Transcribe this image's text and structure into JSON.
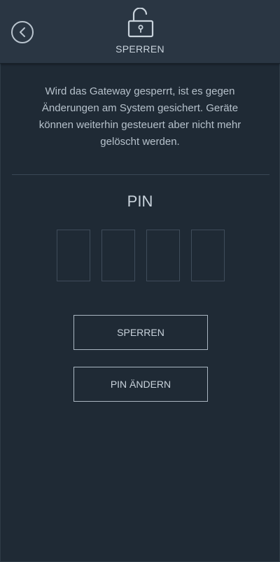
{
  "header": {
    "title": "SPERREN",
    "back_icon": "chevron-left-icon",
    "lock_icon": "unlocked-padlock-icon"
  },
  "main": {
    "description": "Wird das Gateway gesperrt, ist es gegen Änderungen am System gesichert. Geräte können weiterhin gesteuert aber nicht mehr gelöscht werden.",
    "pin_label": "PIN",
    "pin_digits": [
      "",
      "",
      "",
      ""
    ],
    "lock_button_label": "SPERREN",
    "change_pin_button_label": "PIN ÄNDERN"
  },
  "colors": {
    "background": "#1f2a35",
    "header_background": "#2a3643",
    "text": "#c9d3dc",
    "border": "#aab6c1"
  }
}
